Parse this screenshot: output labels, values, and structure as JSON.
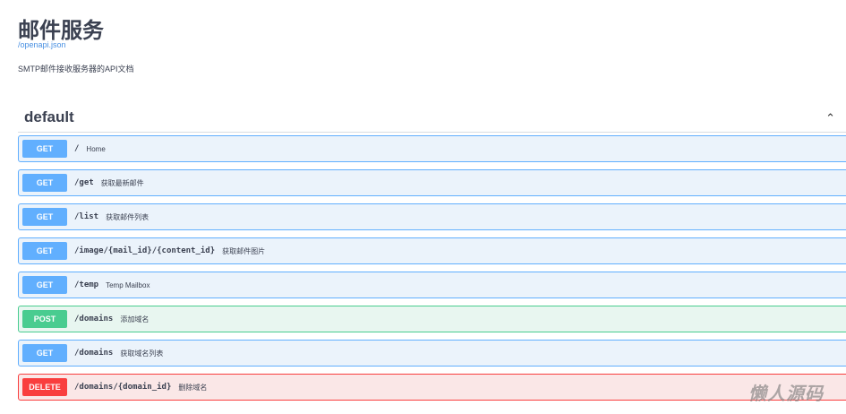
{
  "header": {
    "title": "邮件服务",
    "spec_link": "/openapi.json",
    "description": "SMTP邮件接收服务器的API文档"
  },
  "tag": {
    "name": "default"
  },
  "operations": [
    {
      "method": "GET",
      "path": "/",
      "summary": "Home"
    },
    {
      "method": "GET",
      "path": "/get",
      "summary": "获取最新邮件"
    },
    {
      "method": "GET",
      "path": "/list",
      "summary": "获取邮件列表"
    },
    {
      "method": "GET",
      "path": "/image/{mail_id}/{content_id}",
      "summary": "获取邮件图片"
    },
    {
      "method": "GET",
      "path": "/temp",
      "summary": "Temp Mailbox"
    },
    {
      "method": "POST",
      "path": "/domains",
      "summary": "添加域名"
    },
    {
      "method": "GET",
      "path": "/domains",
      "summary": "获取域名列表"
    },
    {
      "method": "DELETE",
      "path": "/domains/{domain_id}",
      "summary": "删除域名"
    }
  ],
  "watermark": "懒人源码",
  "colors": {
    "get": "#61affe",
    "post": "#49cc90",
    "delete": "#f93e3e"
  }
}
